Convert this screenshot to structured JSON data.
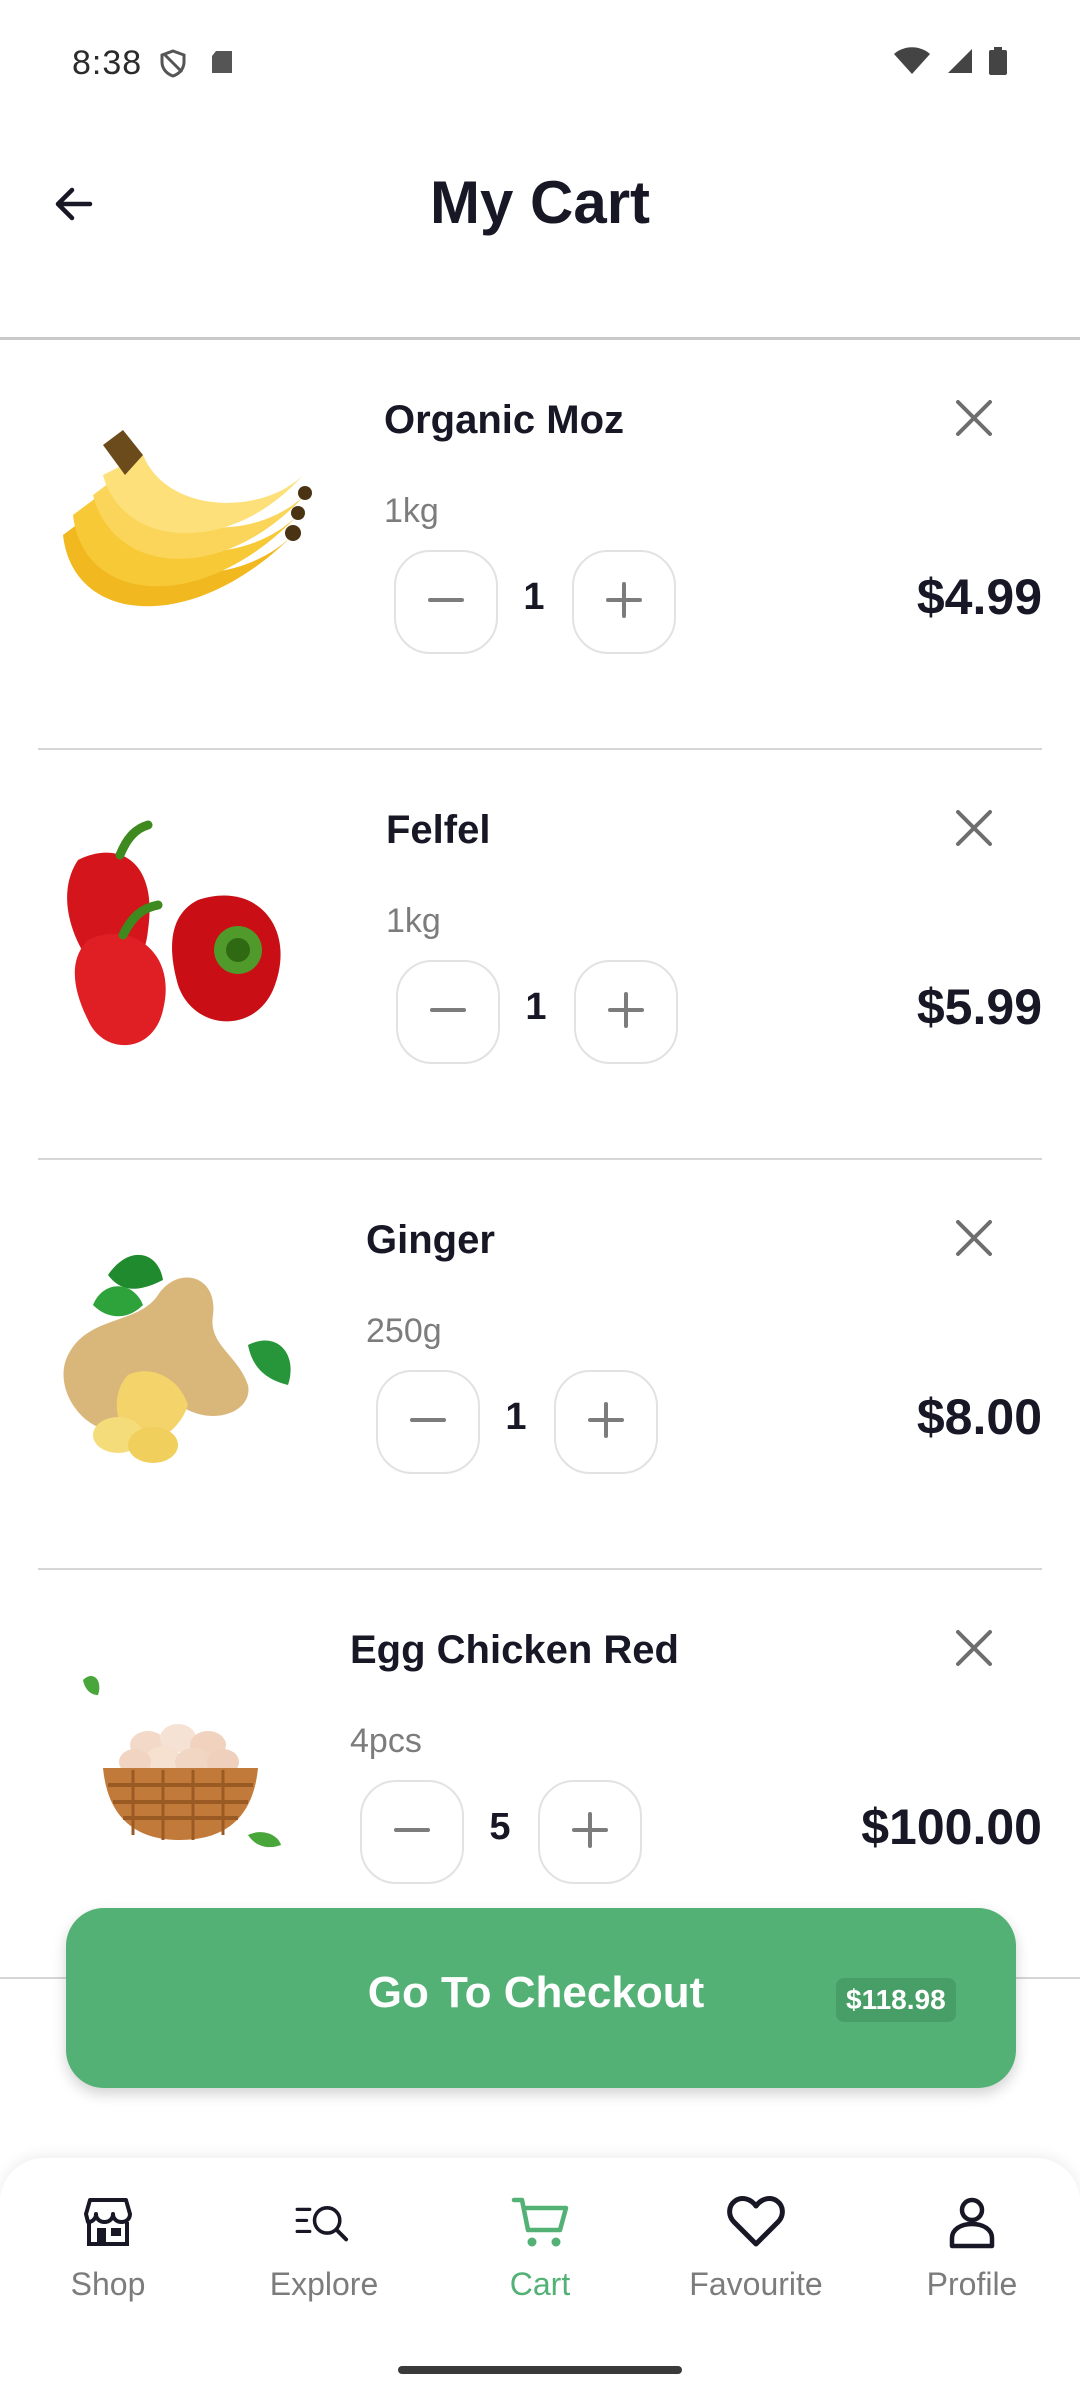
{
  "status_bar": {
    "time": "8:38"
  },
  "header": {
    "title": "My Cart"
  },
  "items": [
    {
      "name": "Organic Moz",
      "unit": "1kg",
      "quantity": "1",
      "price": "$4.99",
      "image": "banana"
    },
    {
      "name": "Felfel",
      "unit": "1kg",
      "quantity": "1",
      "price": "$5.99",
      "image": "pepper"
    },
    {
      "name": "Ginger",
      "unit": "250g",
      "quantity": "1",
      "price": "$8.00",
      "image": "ginger"
    },
    {
      "name": "Egg Chicken Red",
      "unit": "4pcs",
      "quantity": "5",
      "price": "$100.00",
      "image": "eggs"
    }
  ],
  "checkout": {
    "label": "Go To Checkout",
    "total": "$118.98"
  },
  "nav": [
    {
      "label": "Shop",
      "icon": "store-icon"
    },
    {
      "label": "Explore",
      "icon": "search-icon"
    },
    {
      "label": "Cart",
      "icon": "cart-icon",
      "active": true
    },
    {
      "label": "Favourite",
      "icon": "heart-icon"
    },
    {
      "label": "Profile",
      "icon": "person-icon"
    }
  ],
  "colors": {
    "accent": "#53b175",
    "text": "#181725",
    "muted": "#7c7c7c"
  }
}
